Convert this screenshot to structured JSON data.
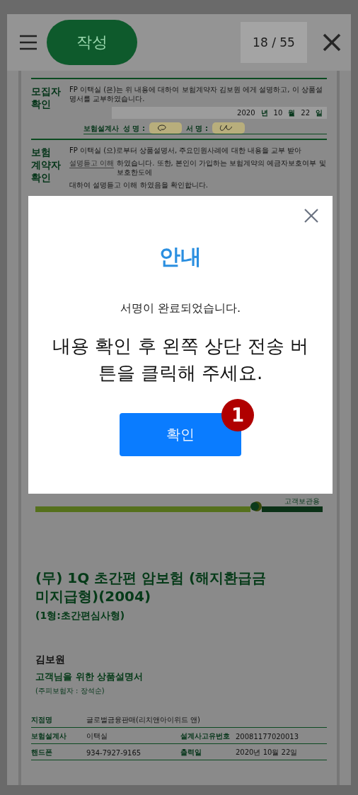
{
  "header": {
    "write_button": "작성",
    "page_counter": "18 / 55"
  },
  "recruiter_section": {
    "heading": "모집자 확인",
    "text": "FP 이택실 (은)는 위 내용에 대하여 보험계약자 김보원 에게 설명하고, 이 상품설명서를 교부하였습니다.",
    "date": [
      "2020",
      "년",
      "10",
      "월",
      "22",
      "일"
    ],
    "role": "보험설계사",
    "name_label": "성 명 :",
    "sign_label": "서 명 :"
  },
  "contractor_section": {
    "heading": "보험 계약자 확인",
    "line_1": "FP 이택실 (으)로부터 상품설명서, 주요민원사례에 대한 내용을 교부 받아",
    "confirm_field": "설명듣고 이해",
    "line_2": "하였습니다. 또한, 본인이 가입하는 보험계약의 예금자보호여부 및 보호한도에",
    "line_3": "대하여 설명듣고 이해 하였음을 확인합니다."
  },
  "document": {
    "copy_label": "고객보관용",
    "title": "(무) 1Q 초간편 암보험 (해지환급금 미지급형)(2004)",
    "subtitle": "(1형:초간편심사형)",
    "customer": "김보원",
    "doc_name": "고객님을 위한 상품설명서",
    "insured": "(주피보험자 : 장석순)",
    "info_rows": [
      {
        "cells": [
          "지점명",
          "글로벌금융판매(리치앤아이위드 앤)"
        ]
      },
      {
        "cells": [
          "보험설계사",
          "이택실",
          "설계사고유번호",
          "20081177020013"
        ]
      },
      {
        "cells": [
          "핸드폰",
          "934-7927-9165",
          "출력일",
          "2020년 10월 22일"
        ]
      }
    ]
  },
  "dialog": {
    "title": "안내",
    "message": "서명이 완료되었습니다.",
    "instruction": "내용 확인 후 왼쪽 상단 전송 버튼을 클릭해 주세요.",
    "confirm_button": "확인",
    "step_badge": "1"
  }
}
